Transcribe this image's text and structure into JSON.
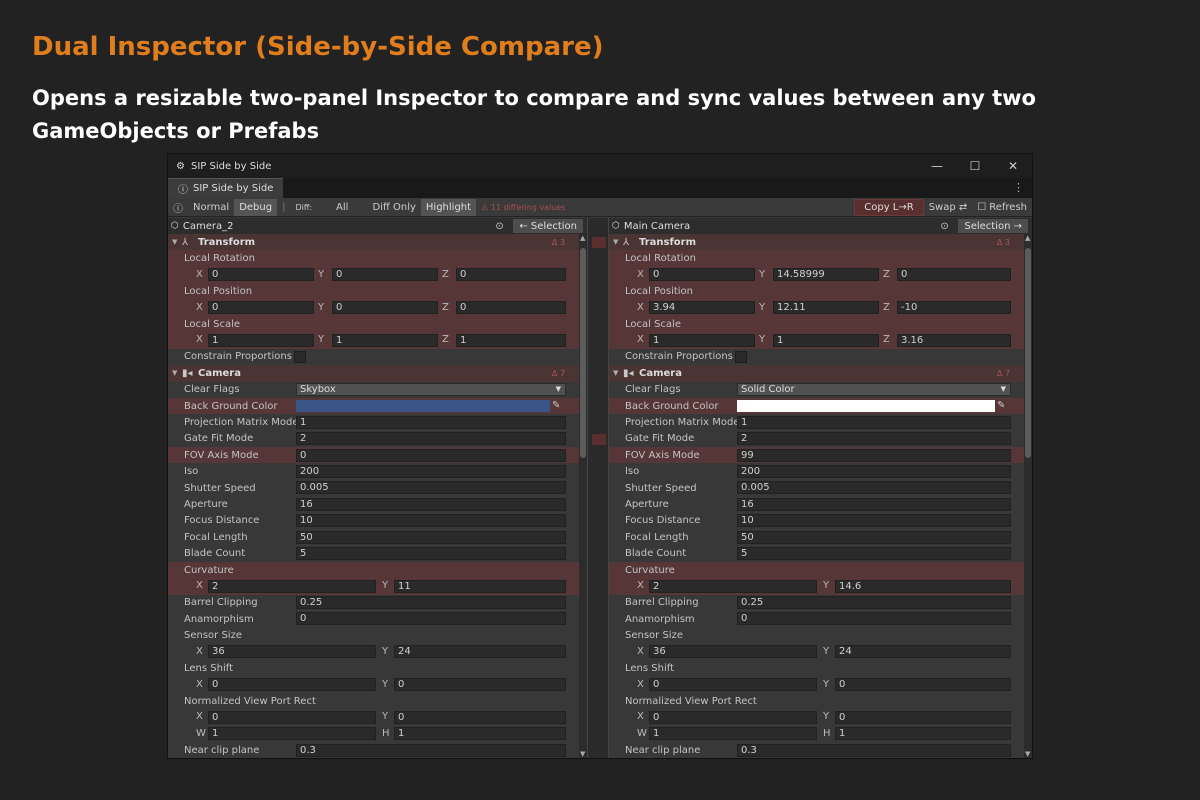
{
  "header": {
    "title": "Dual Inspector (Side-by-Side Compare)",
    "subtitle": "Opens a resizable two-panel Inspector to compare and sync values between any two GameObjects or Prefabs"
  },
  "window": {
    "title": "SIP Side by Side",
    "tab": "SIP Side by Side",
    "min": "—",
    "max": "☐",
    "close": "✕",
    "menu": "⋮"
  },
  "toolbar": {
    "normal": "Normal",
    "debug": "Debug",
    "diff": "Diff:",
    "all": "All",
    "diff_only": "Diff Only",
    "highlight": "Highlight",
    "diff_count": "⚠ 11 differing values",
    "copy": "Copy L→R",
    "swap": "Swap ⇄",
    "refresh": "Refresh"
  },
  "left": {
    "object": "Camera_2",
    "sel_btn": "← Selection",
    "transform": {
      "title": "Transform",
      "badge": "Δ 3",
      "rot_label": "Local Rotation",
      "rot": [
        "0",
        "0",
        "0"
      ],
      "pos_label": "Local Position",
      "pos": [
        "0",
        "0",
        "0"
      ],
      "scale_label": "Local Scale",
      "scale": [
        "1",
        "1",
        "1"
      ],
      "constrain": "Constrain Proportions S"
    },
    "camera": {
      "title": "Camera",
      "badge": "Δ 7",
      "clear_flags_label": "Clear Flags",
      "clear_flags": "Skybox",
      "bg_label": "Back Ground Color",
      "bg_color": "#3a5587",
      "proj_label": "Projection Matrix Mode",
      "proj": "1",
      "gate_label": "Gate Fit Mode",
      "gate": "2",
      "fov_label": "FOV Axis Mode",
      "fov": "0",
      "iso_label": "Iso",
      "iso": "200",
      "shutter_label": "Shutter Speed",
      "shutter": "0.005",
      "aperture_label": "Aperture",
      "aperture": "16",
      "focus_label": "Focus Distance",
      "focus": "10",
      "focal_label": "Focal Length",
      "focal": "50",
      "blade_label": "Blade Count",
      "blade": "5",
      "curv_label": "Curvature",
      "curv": [
        "2",
        "11"
      ],
      "barrel_label": "Barrel Clipping",
      "barrel": "0.25",
      "anamorph_label": "Anamorphism",
      "anamorph": "0",
      "sensor_label": "Sensor Size",
      "sensor": [
        "36",
        "24"
      ],
      "lens_label": "Lens Shift",
      "lens": [
        "0",
        "0"
      ],
      "vp_label": "Normalized View Port Rect",
      "vp": [
        "0",
        "0",
        "1",
        "1"
      ],
      "near_label": "Near clip plane",
      "near": "0.3"
    }
  },
  "right": {
    "object": "Main Camera",
    "sel_btn": "Selection →",
    "transform": {
      "title": "Transform",
      "badge": "Δ 3",
      "rot_label": "Local Rotation",
      "rot": [
        "0",
        "14.58999",
        "0"
      ],
      "pos_label": "Local Position",
      "pos": [
        "3.94",
        "12.11",
        "-10"
      ],
      "scale_label": "Local Scale",
      "scale": [
        "1",
        "1",
        "3.16"
      ],
      "constrain": "Constrain Proportions S"
    },
    "camera": {
      "title": "Camera",
      "badge": "Δ 7",
      "clear_flags_label": "Clear Flags",
      "clear_flags": "Solid Color",
      "bg_label": "Back Ground Color",
      "bg_color": "#ffffff",
      "proj_label": "Projection Matrix Mode",
      "proj": "1",
      "gate_label": "Gate Fit Mode",
      "gate": "2",
      "fov_label": "FOV Axis Mode",
      "fov": "99",
      "iso_label": "Iso",
      "iso": "200",
      "shutter_label": "Shutter Speed",
      "shutter": "0.005",
      "aperture_label": "Aperture",
      "aperture": "16",
      "focus_label": "Focus Distance",
      "focus": "10",
      "focal_label": "Focal Length",
      "focal": "50",
      "blade_label": "Blade Count",
      "blade": "5",
      "curv_label": "Curvature",
      "curv": [
        "2",
        "14.6"
      ],
      "barrel_label": "Barrel Clipping",
      "barrel": "0.25",
      "anamorph_label": "Anamorphism",
      "anamorph": "0",
      "sensor_label": "Sensor Size",
      "sensor": [
        "36",
        "24"
      ],
      "lens_label": "Lens Shift",
      "lens": [
        "0",
        "0"
      ],
      "vp_label": "Normalized View Port Rect",
      "vp": [
        "0",
        "0",
        "1",
        "1"
      ],
      "near_label": "Near clip plane",
      "near": "0.3"
    }
  },
  "axes": {
    "x": "X",
    "y": "Y",
    "z": "Z",
    "w": "W",
    "h": "H"
  },
  "colors": {
    "accent": "#e07d1c",
    "diff_row": "#563636"
  }
}
